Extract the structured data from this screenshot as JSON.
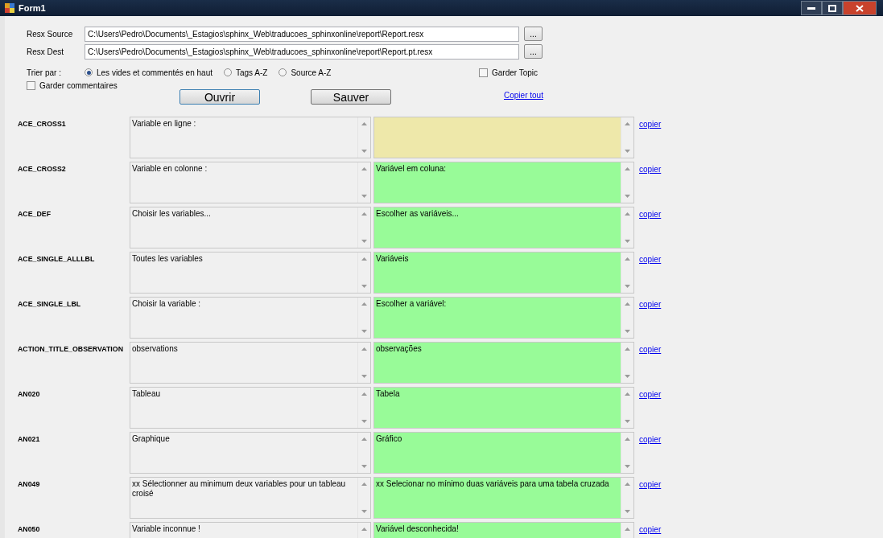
{
  "window": {
    "title": "Form1"
  },
  "source": {
    "label": "Resx Source",
    "value": "C:\\Users\\Pedro\\Documents\\_Estagios\\sphinx_Web\\traducoes_sphinxonline\\report\\Report.resx",
    "browse": "..."
  },
  "dest": {
    "label": "Resx Dest",
    "value": "C:\\Users\\Pedro\\Documents\\_Estagios\\sphinx_Web\\traducoes_sphinxonline\\report\\Report.pt.resx",
    "browse": "..."
  },
  "sort": {
    "label": "Trier par :",
    "options": [
      {
        "label": "Les vides et commentés en haut",
        "selected": true
      },
      {
        "label": "Tags A-Z",
        "selected": false
      },
      {
        "label": "Source A-Z",
        "selected": false
      }
    ]
  },
  "keep_topic": {
    "label": "Garder Topic",
    "checked": false
  },
  "keep_comments": {
    "label": "Garder commentaires",
    "checked": false
  },
  "buttons": [
    "Ouvrir",
    "Sauver"
  ],
  "copy_all": "Copier tout",
  "rows": [
    {
      "key": "ACE_CROSS1",
      "source": "Variable en ligne :",
      "target": "",
      "empty": true,
      "copy": "copier"
    },
    {
      "key": "ACE_CROSS2",
      "source": "Variable en colonne :",
      "target": "Variável em coluna:",
      "empty": false,
      "copy": "copier"
    },
    {
      "key": "ACE_DEF",
      "source": "Choisir les variables...",
      "target": "Escolher as variáveis...",
      "empty": false,
      "copy": "copier"
    },
    {
      "key": "ACE_SINGLE_ALLLBL",
      "source": "Toutes les variables",
      "target": "Variáveis",
      "empty": false,
      "copy": "copier"
    },
    {
      "key": "ACE_SINGLE_LBL",
      "source": "Choisir la variable :",
      "target": "Escolher a variável:",
      "empty": false,
      "copy": "copier"
    },
    {
      "key": "ACTION_TITLE_OBSERVATION",
      "source": "observations",
      "target": "observações",
      "empty": false,
      "copy": "copier"
    },
    {
      "key": "AN020",
      "source": "Tableau",
      "target": "Tabela",
      "empty": false,
      "copy": "copier"
    },
    {
      "key": "AN021",
      "source": "Graphique",
      "target": "Gráfico",
      "empty": false,
      "copy": "copier"
    },
    {
      "key": "AN049",
      "source": "xx Sélectionner au minimum deux variables pour un tableau croisé",
      "target": "xx Selecionar no mínimo duas variáveis para uma tabela cruzada",
      "empty": false,
      "copy": "copier"
    },
    {
      "key": "AN050",
      "source": "Variable inconnue !",
      "target": "Variável desconhecida!",
      "empty": false,
      "copy": "copier"
    }
  ]
}
